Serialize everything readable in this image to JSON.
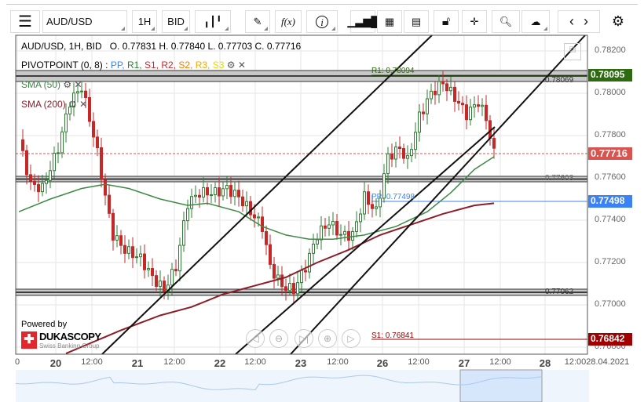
{
  "toolbar": {
    "menu_icon": "hamburger-icon",
    "symbol": "AUD/USD",
    "timeframe": "1H",
    "side": "BID",
    "icons": [
      "candles-icon",
      "pencil-icon",
      "fx-icon",
      "info-icon",
      "volume-bars-icon",
      "calendar-icon",
      "report-icon",
      "unlock-icon",
      "crosshair-icon",
      "zoom-search-icon",
      "cloud-upload-icon",
      "chevron-left-icon",
      "chevron-right-icon",
      "gear-icon"
    ],
    "fx": "f(x)",
    "info": "i"
  },
  "legend": {
    "instrument": "AUD/USD, 1H, BID",
    "ohlc": "O. 0.77831 H. 0.77840 L. 0.77703 C. 0.77716",
    "pivot_name": "PIVOTPOINT (0, 8)",
    "pivot_sep": " : ",
    "pivot_items": [
      {
        "label": "PP",
        "color": "#3b82f6"
      },
      {
        "label": "R1",
        "color": "#2e7d32"
      },
      {
        "label": "S1",
        "color": "#c62828"
      },
      {
        "label": "R2",
        "color": "#c62828"
      },
      {
        "label": "S2",
        "color": "#f57c00"
      },
      {
        "label": "R3",
        "color": "#f5a800"
      },
      {
        "label": "S3",
        "color": "#e6d800"
      }
    ],
    "sma50": "SMA (50)",
    "sma200": "SMA (200)"
  },
  "price_axis": {
    "ticks": [
      "0.78200",
      "0.78000",
      "0.77800",
      "0.77600",
      "0.77400",
      "0.77200",
      "0.77000",
      "0.76800"
    ],
    "tags": {
      "r1": "0.78095",
      "last": "0.77716",
      "pp": "0.77498",
      "s1": "0.76842"
    }
  },
  "levels": {
    "band_top": "0.78069",
    "band_mid": "0.77603",
    "band_low": "0.77062",
    "r1": "R1: 0.78094",
    "pp": "PP: 0.77498",
    "s1": "S1: 0.76841"
  },
  "time_axis": [
    {
      "t": "0",
      "day": false
    },
    {
      "t": "20",
      "day": true
    },
    {
      "t": "12:00",
      "day": false
    },
    {
      "t": "21",
      "day": true
    },
    {
      "t": "12:00",
      "day": false
    },
    {
      "t": "22",
      "day": true
    },
    {
      "t": "12:00",
      "day": false
    },
    {
      "t": "23",
      "day": true
    },
    {
      "t": "12:00",
      "day": false
    },
    {
      "t": "26",
      "day": true
    },
    {
      "t": "12:00",
      "day": false
    },
    {
      "t": "27",
      "day": true
    },
    {
      "t": "12:00",
      "day": false
    },
    {
      "t": "28",
      "day": true
    },
    {
      "t": "12:0028.04.2021",
      "day": false
    }
  ],
  "branding": {
    "powered": "Powered by",
    "name": "DUKASCOPY",
    "tagline": "Swiss Banking Group"
  },
  "colors": {
    "up": "#2e7d32",
    "down": "#c62828",
    "sma50": "#3d8a45",
    "sma200": "#8b1e2a",
    "r1": "#2e6b10",
    "last": "#d9534f",
    "pp": "#3b82f6",
    "s1": "#a00000"
  },
  "chart_data": {
    "type": "candlestick",
    "ylim": [
      0.7676,
      0.7824
    ],
    "close_path": [
      [
        0,
        0.7778
      ],
      [
        3,
        0.7757
      ],
      [
        6,
        0.7755
      ],
      [
        10,
        0.7774
      ],
      [
        13,
        0.7796
      ],
      [
        16,
        0.7803
      ],
      [
        18,
        0.7788
      ],
      [
        20,
        0.7772
      ],
      [
        22,
        0.7751
      ],
      [
        24,
        0.7733
      ],
      [
        27,
        0.7726
      ],
      [
        31,
        0.7722
      ],
      [
        34,
        0.7713
      ],
      [
        37,
        0.7707
      ],
      [
        40,
        0.7718
      ],
      [
        43,
        0.7748
      ],
      [
        46,
        0.7753
      ],
      [
        50,
        0.7753
      ],
      [
        53,
        0.7755
      ],
      [
        56,
        0.7751
      ],
      [
        59,
        0.7744
      ],
      [
        62,
        0.7737
      ],
      [
        64,
        0.7718
      ],
      [
        67,
        0.7709
      ],
      [
        70,
        0.7707
      ],
      [
        73,
        0.7718
      ],
      [
        76,
        0.7733
      ],
      [
        79,
        0.7739
      ],
      [
        82,
        0.7733
      ],
      [
        85,
        0.7733
      ],
      [
        88,
        0.7751
      ],
      [
        91,
        0.7744
      ],
      [
        94,
        0.777
      ],
      [
        97,
        0.7774
      ],
      [
        99,
        0.7768
      ],
      [
        102,
        0.7789
      ],
      [
        105,
        0.78
      ],
      [
        108,
        0.7805
      ],
      [
        111,
        0.7798
      ],
      [
        114,
        0.779
      ],
      [
        117,
        0.7796
      ],
      [
        119,
        0.7788
      ],
      [
        121,
        0.77716
      ]
    ],
    "sma50": [
      [
        0,
        0.7744
      ],
      [
        8,
        0.775
      ],
      [
        16,
        0.7755
      ],
      [
        22,
        0.7757
      ],
      [
        28,
        0.7755
      ],
      [
        36,
        0.775
      ],
      [
        43,
        0.7747
      ],
      [
        48,
        0.7748
      ],
      [
        56,
        0.7744
      ],
      [
        62,
        0.7737
      ],
      [
        68,
        0.7733
      ],
      [
        74,
        0.7731
      ],
      [
        80,
        0.7731
      ],
      [
        88,
        0.7733
      ],
      [
        96,
        0.7737
      ],
      [
        104,
        0.7744
      ],
      [
        110,
        0.7753
      ],
      [
        116,
        0.7764
      ],
      [
        121,
        0.777
      ]
    ],
    "sma200": [
      [
        12,
        0.7677
      ],
      [
        26,
        0.7688
      ],
      [
        36,
        0.7695
      ],
      [
        44,
        0.7699
      ],
      [
        52,
        0.7705
      ],
      [
        60,
        0.7709
      ],
      [
        68,
        0.7713
      ],
      [
        76,
        0.772
      ],
      [
        84,
        0.7726
      ],
      [
        92,
        0.7733
      ],
      [
        100,
        0.7738
      ],
      [
        108,
        0.7743
      ],
      [
        116,
        0.7747
      ],
      [
        121,
        0.7748
      ]
    ]
  }
}
